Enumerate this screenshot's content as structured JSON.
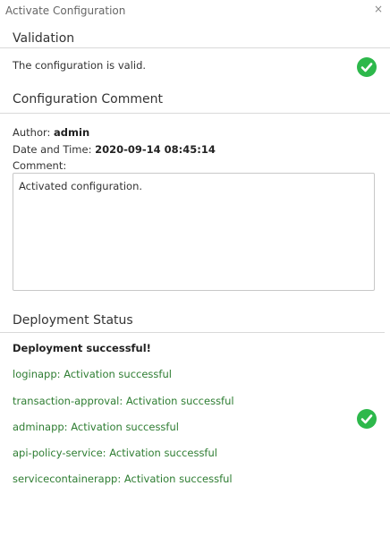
{
  "dialog": {
    "title": "Activate Configuration",
    "close_glyph": "×"
  },
  "validation": {
    "header": "Validation",
    "message": "The configuration is valid.",
    "status_icon": "check-circle-icon",
    "status_color": "#2db84b"
  },
  "configuration_comment": {
    "header": "Configuration Comment",
    "author_label": "Author:",
    "author_value": "admin",
    "datetime_label": "Date and Time:",
    "datetime_value": "2020-09-14 08:45:14",
    "comment_label": "Comment:",
    "comment_value": "Activated configuration."
  },
  "deployment_status": {
    "header": "Deployment Status",
    "summary": "Deployment successful!",
    "status_icon": "check-circle-icon",
    "status_color": "#2db84b",
    "items": [
      "loginapp: Activation successful",
      "transaction-approval: Activation successful",
      "adminapp: Activation successful",
      "api-policy-service: Activation successful",
      "servicecontainerapp: Activation successful"
    ],
    "item_color": "#2e7d32"
  }
}
